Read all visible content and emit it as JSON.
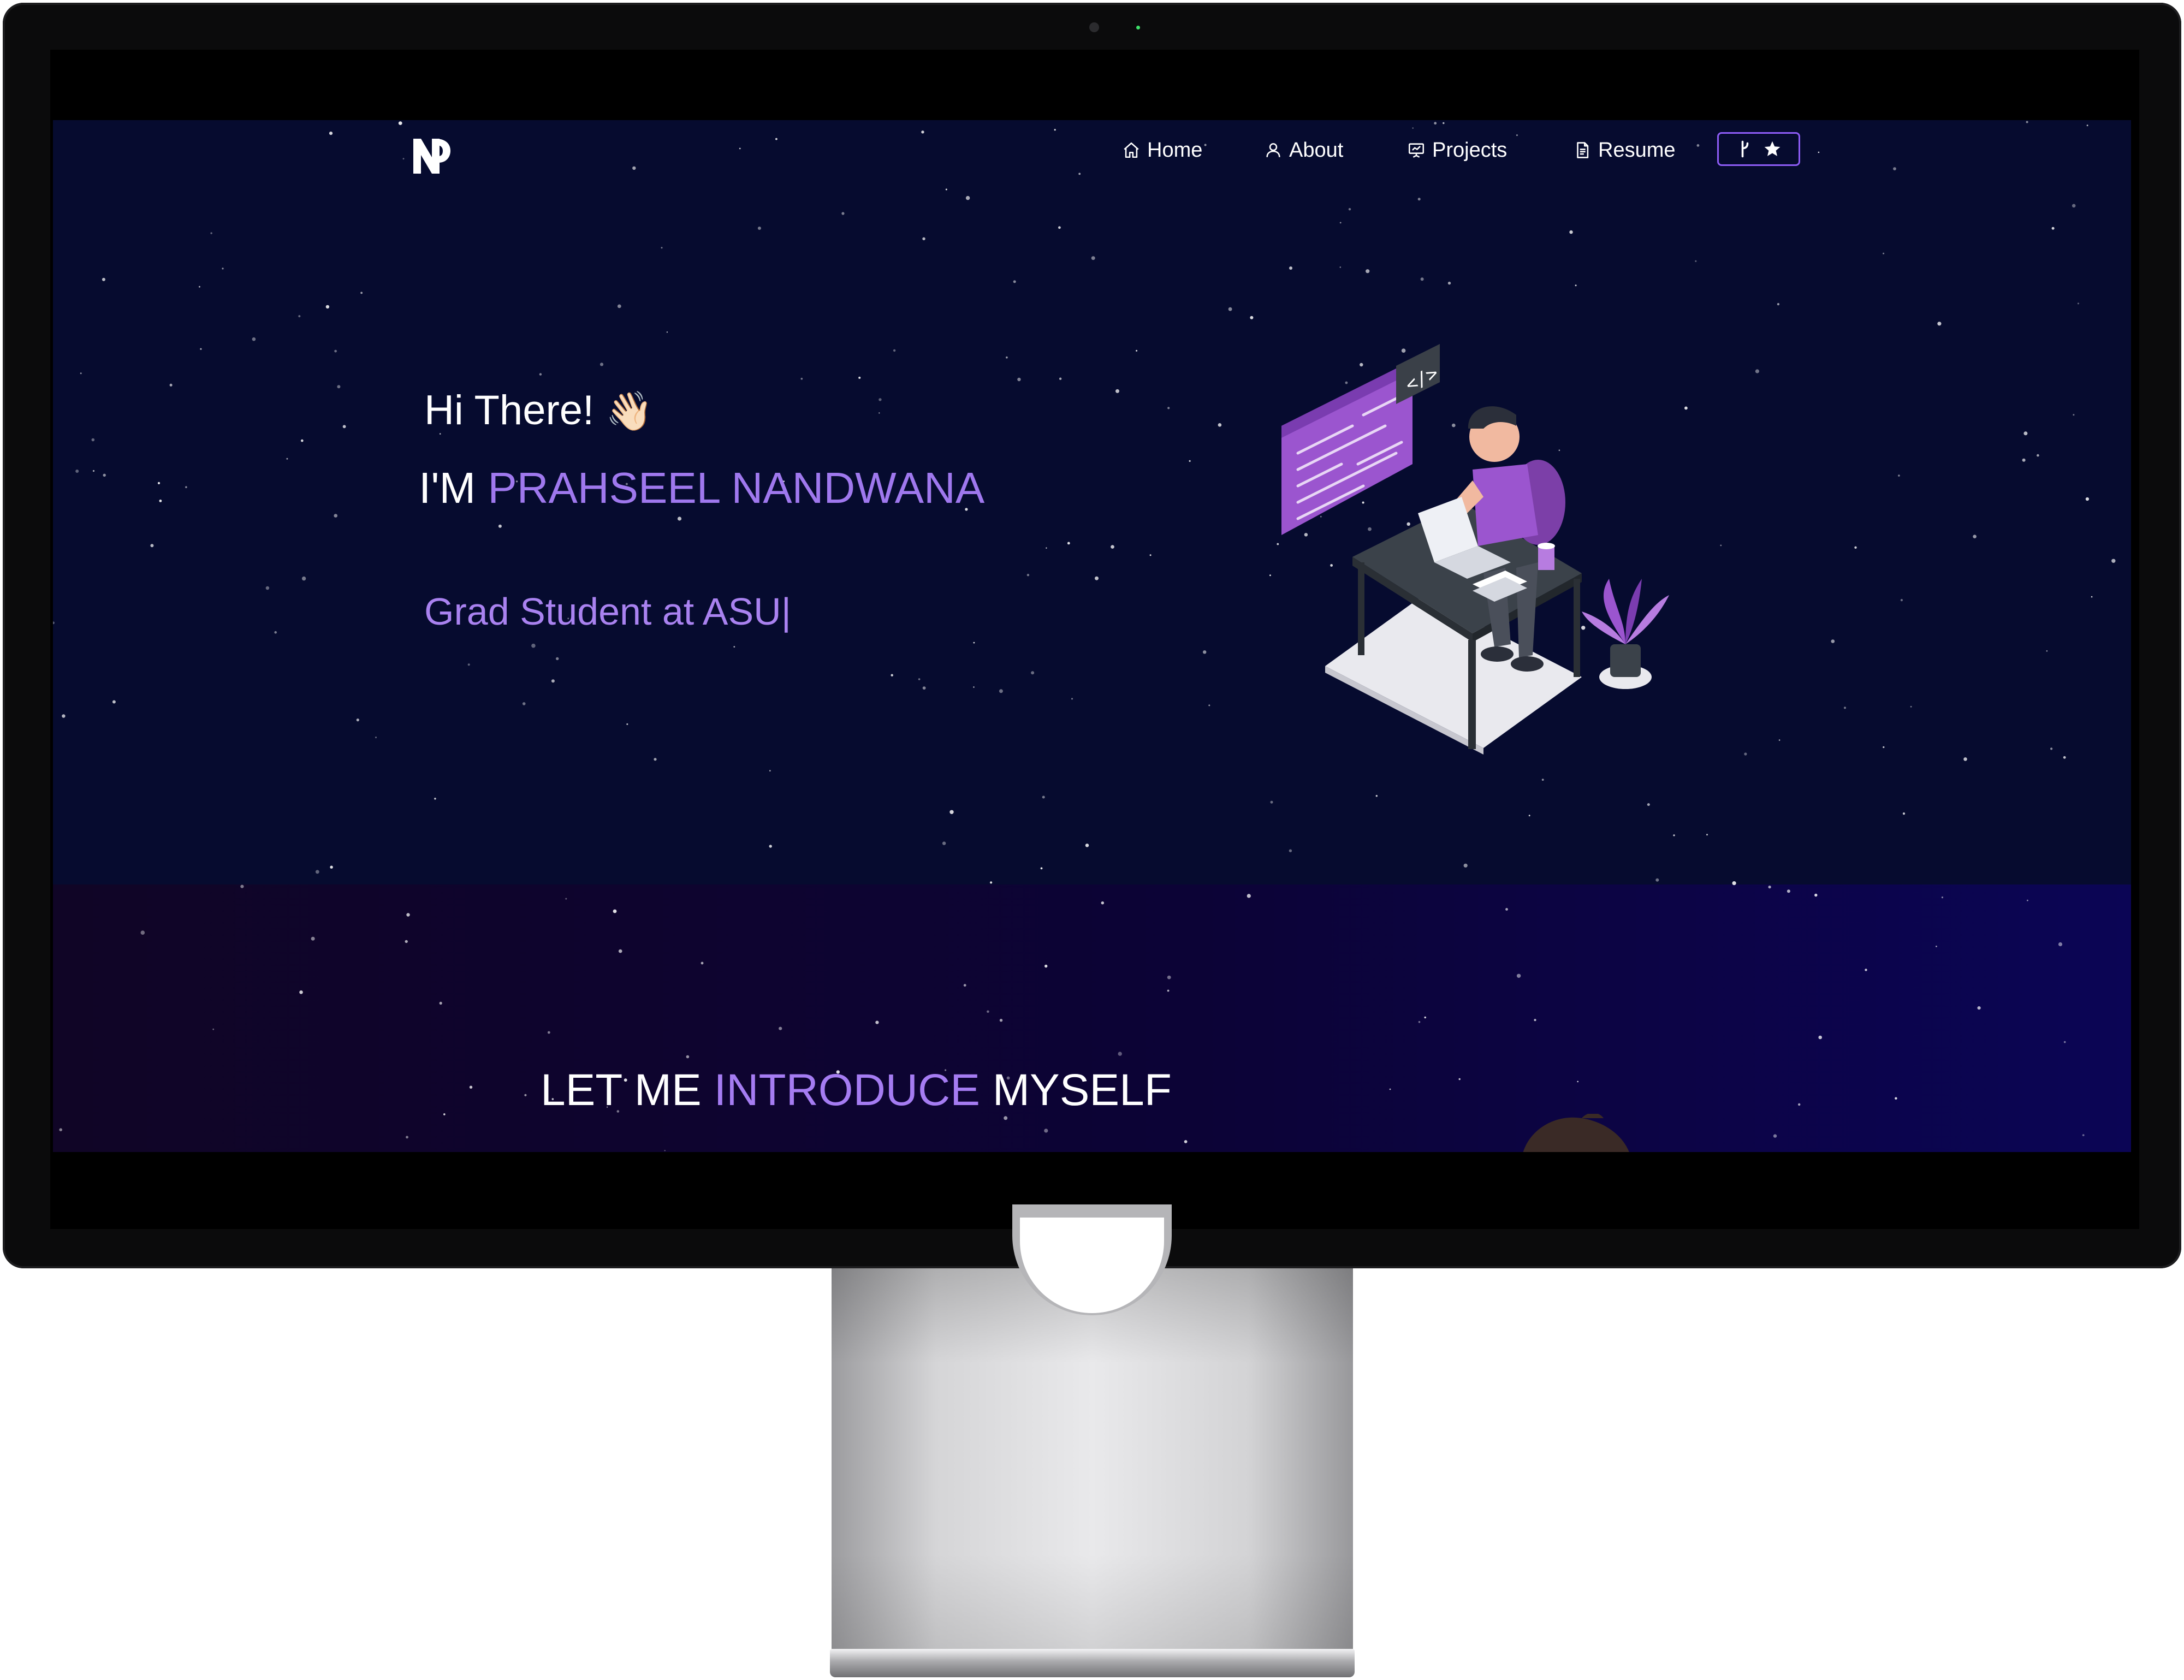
{
  "navbar": {
    "logo_alt": "PN logo",
    "items": [
      {
        "label": "Home",
        "icon": "home-icon"
      },
      {
        "label": "About",
        "icon": "user-icon"
      },
      {
        "label": "Projects",
        "icon": "presentation-icon"
      },
      {
        "label": "Resume",
        "icon": "document-icon"
      }
    ],
    "github_button": {
      "icons": [
        "git-fork-icon",
        "star-icon"
      ]
    }
  },
  "hero": {
    "greeting": "Hi There!",
    "wave_emoji": "👋🏻",
    "im_prefix": "I'M ",
    "name": "PRAHSEEL NANDWANA",
    "typewriter": "Grad Student at ASU",
    "cursor": "|"
  },
  "about": {
    "heading_part1": "LET ME ",
    "heading_highlight": "INTRODUCE",
    "heading_part2": " MYSELF"
  },
  "colors": {
    "hero_bg": "#060b2f",
    "accent": "#9f78ee",
    "about_bg_start": "#100526",
    "about_bg_end": "#0b0555",
    "nav_border": "#8d5cf6"
  }
}
